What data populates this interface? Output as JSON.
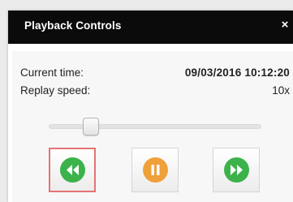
{
  "panel": {
    "title": "Playback Controls",
    "close_glyph": "×"
  },
  "info": {
    "current_time_label": "Current time:",
    "current_time_value": "09/03/2016 10:12:20",
    "replay_speed_label": "Replay speed:",
    "replay_speed_value": "10x"
  },
  "speed_slider": {
    "position_fraction": 0.2
  },
  "controls": [
    {
      "name": "rewind-button",
      "icon": "rewind-icon",
      "color": "#3cb24a",
      "active": true
    },
    {
      "name": "pause-button",
      "icon": "pause-icon",
      "color": "#f0a03a",
      "active": false
    },
    {
      "name": "fast-forward-button",
      "icon": "fast-forward-icon",
      "color": "#3cb24a",
      "active": false
    }
  ],
  "colors": {
    "titlebar": "#0b0b0b",
    "active_border": "#e57373",
    "green": "#3cb24a",
    "orange": "#f0a03a"
  }
}
